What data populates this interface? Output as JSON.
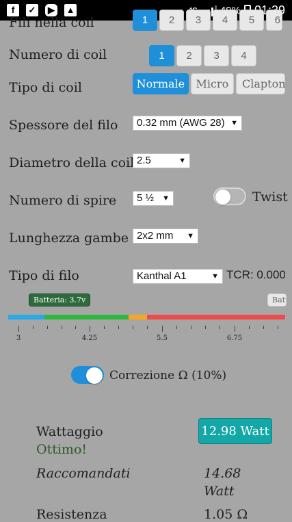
{
  "status_bar": {
    "left_icons": [
      "facebook-icon",
      "checked-box-icon",
      "youtube-icon",
      "gallery-icon"
    ],
    "network": "4G",
    "battery": "49%",
    "time": "01:39"
  },
  "coils_in_coil": {
    "label": "Fili nella coil",
    "options": [
      "1",
      "2",
      "3",
      "4",
      "5",
      "6"
    ],
    "selected": "1"
  },
  "coil_count": {
    "label": "Numero di coil",
    "options": [
      "1",
      "2",
      "3",
      "4"
    ],
    "selected": "1"
  },
  "coil_type": {
    "label": "Tipo di coil",
    "options": [
      "Normale",
      "Micro",
      "Clapton"
    ],
    "selected": "Normale"
  },
  "wire_thickness": {
    "label": "Spessore del filo",
    "value": "0.32 mm (AWG 28)"
  },
  "coil_diameter": {
    "label": "Diametro della coil",
    "value": "2.5"
  },
  "wraps": {
    "label": "Numero di spire",
    "value": "5 ½"
  },
  "twist": {
    "label": "Twist",
    "enabled": false
  },
  "leg_length": {
    "label": "Lunghezza gambe",
    "value": "2x2 mm"
  },
  "wire_type": {
    "label": "Tipo di filo",
    "value": "Kanthal A1",
    "tcr": "TCR: 0.000"
  },
  "battery_scale": {
    "badge": "Batteria: 3.7v",
    "badge_right": "Batt",
    "tick_labels": [
      "3",
      "4.25",
      "5.5",
      "6.75"
    ],
    "colors": {
      "blue": "#29a9e6",
      "green": "#2db83d",
      "orange": "#f5a623",
      "red": "#ee4b4b"
    }
  },
  "ohm_correction": {
    "label": "Correzione Ω (10%)",
    "enabled": true
  },
  "results": {
    "wattage_label": "Wattaggio",
    "wattage_value": "12.98 Watt",
    "wattage_status": "Ottimo!",
    "recommended_label": "Raccomandati",
    "recommended_value": "14.68",
    "recommended_unit": "Watt",
    "resistance_label": "Resistenza",
    "resistance_value": "1.05 Ω"
  }
}
